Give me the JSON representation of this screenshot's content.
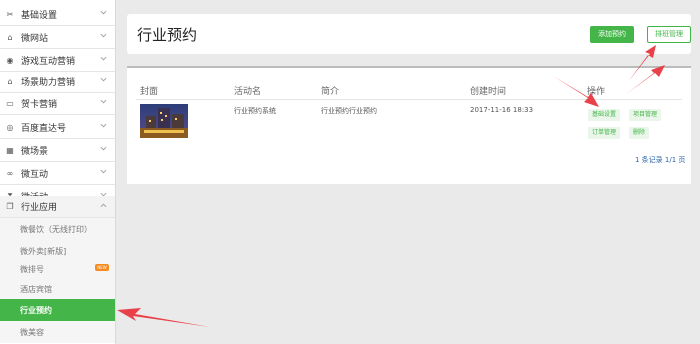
{
  "sidebar": {
    "items": [
      {
        "label": "基础设置",
        "icon": "tools-icon"
      },
      {
        "label": "微网站",
        "icon": "home-icon"
      },
      {
        "label": "游戏互动营销",
        "icon": "gamepad-icon"
      },
      {
        "label": "场景助力营销",
        "icon": "bank-icon"
      },
      {
        "label": "贺卡营销",
        "icon": "card-icon"
      },
      {
        "label": "百度直达号",
        "icon": "target-icon"
      },
      {
        "label": "微场景",
        "icon": "grid-icon"
      },
      {
        "label": "微互动",
        "icon": "infinity-icon"
      },
      {
        "label": "微活动",
        "icon": "hourglass-icon"
      },
      {
        "label": "行业应用",
        "icon": "app-icon"
      }
    ],
    "subitems": [
      {
        "label": "微餐饮（无线打印）"
      },
      {
        "label": "微外卖[新版]"
      },
      {
        "label": "微排号",
        "badge": "NEW"
      },
      {
        "label": "酒店宾馆"
      },
      {
        "label": "行业预约"
      },
      {
        "label": "微美容"
      }
    ]
  },
  "header": {
    "title": "行业预约",
    "add_label": "添加预约",
    "sort_label": "排班管理"
  },
  "table": {
    "columns": [
      "封面",
      "活动名",
      "简介",
      "创建时间",
      "操作"
    ],
    "rows": [
      {
        "name": "行业预约系统",
        "intro": "行业预约行业预约",
        "created": "2017-11-16 18:33",
        "actions": [
          "基础设置",
          "项目管理",
          "订单管理",
          "删除"
        ]
      }
    ],
    "pager": "1 条记录 1/1 页"
  },
  "colors": {
    "accent": "#44b549",
    "arrow": "#e8414a"
  }
}
